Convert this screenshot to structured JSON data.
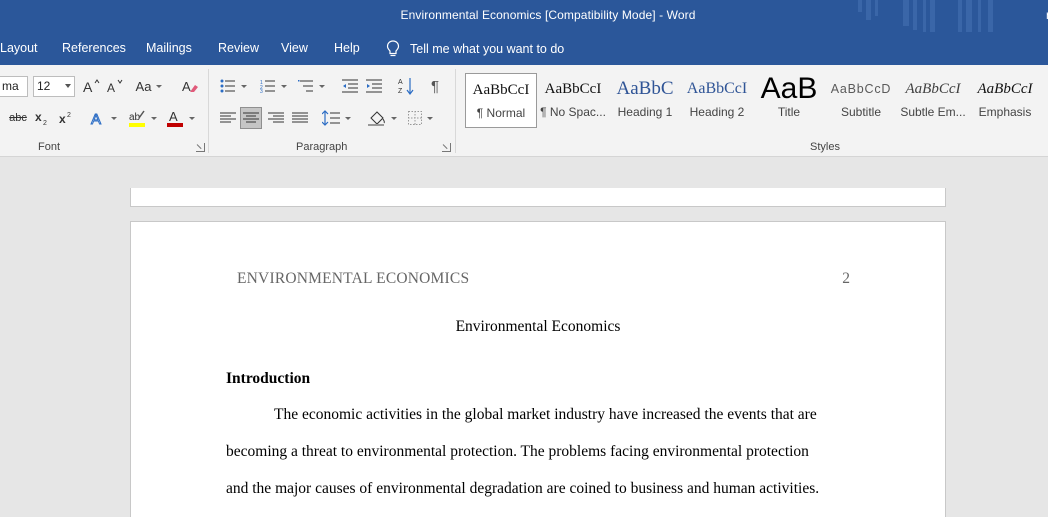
{
  "window": {
    "title": "Environmental Economics [Compatibility Mode]  -  Word",
    "user_initial": "r"
  },
  "tabs": [
    {
      "label": "Layout"
    },
    {
      "label": "References"
    },
    {
      "label": "Mailings"
    },
    {
      "label": "Review"
    },
    {
      "label": "View"
    },
    {
      "label": "Help"
    }
  ],
  "tell_me": {
    "label": "Tell me what you want to do",
    "icon": "lightbulb-icon"
  },
  "ribbon": {
    "font": {
      "group_label": "Font",
      "font_name": "ma",
      "font_size": "12",
      "change_case_label": "Aa",
      "strikethrough_label": "abc",
      "highlight_color": "#ffff00",
      "font_color": "#c00000"
    },
    "paragraph": {
      "group_label": "Paragraph"
    },
    "styles": {
      "group_label": "Styles",
      "items": [
        {
          "sample": "AaBbCcI",
          "name": "¶ Normal",
          "selected": true
        },
        {
          "sample": "AaBbCcI",
          "name": "¶ No Spac..."
        },
        {
          "sample": "AaBbC",
          "name": "Heading 1"
        },
        {
          "sample": "AaBbCcI",
          "name": "Heading 2"
        },
        {
          "sample": "AaB",
          "name": "Title"
        },
        {
          "sample": "AaBbCcD",
          "name": "Subtitle"
        },
        {
          "sample": "AaBbCcI",
          "name": "Subtle Em..."
        },
        {
          "sample": "AaBbCcI",
          "name": "Emphasis"
        }
      ]
    }
  },
  "document": {
    "running_head": "ENVIRONMENTAL ECONOMICS",
    "page_number": "2",
    "title": "Environmental Economics",
    "heading": "Introduction",
    "lines": [
      "The economic activities in the global market industry have increased the events that are",
      "becoming a threat to environmental protection. The problems facing environmental protection",
      "and the major causes of environmental degradation are coined to business and human activities."
    ]
  },
  "colors": {
    "brand_blue": "#2b579a",
    "ribbon_bg": "#f3f3f3",
    "canvas_bg": "#e6e6e6"
  }
}
